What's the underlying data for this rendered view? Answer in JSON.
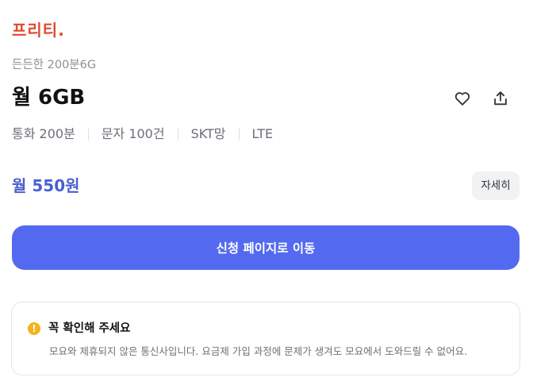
{
  "brand": {
    "logo_text": "프리티."
  },
  "plan": {
    "name": "든든한 200분6G",
    "title": "월 6GB",
    "specs": [
      "통화 200분",
      "문자 100건",
      "SKT망",
      "LTE"
    ],
    "price": "월 550원"
  },
  "buttons": {
    "detail": "자세히",
    "apply": "신청 페이지로 이동"
  },
  "icons": {
    "favorite": "heart-icon",
    "share": "share-icon",
    "notice": "warning-icon"
  },
  "notice": {
    "icon_glyph": "!",
    "title": "꼭 확인해 주세요",
    "body": "모요와 제휴되지 않은 통신사입니다. 요금제 가입 과정에 문제가 생겨도 모요에서 도와드릴 수 없어요."
  },
  "colors": {
    "brand": "#e04a2f",
    "accent": "#536af0",
    "price": "#4a5fd1",
    "warning": "#f5b21a"
  }
}
